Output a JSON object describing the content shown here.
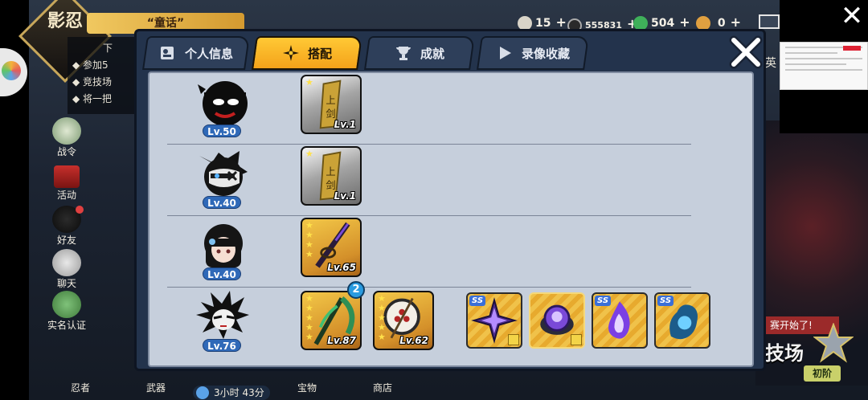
{
  "background": {
    "logo_text": "影忍",
    "banner_text": "“童话”",
    "quests": {
      "top": "下",
      "items": [
        "参加5",
        "竞技场",
        "将一把"
      ]
    },
    "side_buttons": [
      {
        "label": "战令",
        "icon": "battle-pass-icon"
      },
      {
        "label": "活动",
        "icon": "torii-gate-icon"
      },
      {
        "label": "好友",
        "icon": "friends-icon"
      },
      {
        "label": "聊天",
        "icon": "chat-icon"
      },
      {
        "label": "实名认证",
        "icon": "verify-icon"
      }
    ],
    "bottom_nav": [
      "忍者",
      "武器",
      "宝物",
      "商店"
    ],
    "timer": "3小时 43分",
    "resources": {
      "gold": "15",
      "silver": "555831",
      "gems": "504",
      "keys": "0"
    },
    "arena_banner": "赛开始了!",
    "arena_text": "技场",
    "rank_badge": "初阶",
    "right_edge_text": "英"
  },
  "modal": {
    "tabs": [
      {
        "label": "个人信息",
        "icon": "profile-card-icon",
        "active": false
      },
      {
        "label": "搭配",
        "icon": "shuriken-icon",
        "active": true
      },
      {
        "label": "成就",
        "icon": "trophy-icon",
        "active": false
      },
      {
        "label": "录像收藏",
        "icon": "play-icon",
        "active": false
      }
    ],
    "rows": [
      {
        "character": "stickman-ninja",
        "level": "Lv.50",
        "items": [
          {
            "type": "scroll",
            "frame": "silver",
            "stars": 1,
            "level": "Lv.1"
          }
        ],
        "skills": []
      },
      {
        "character": "masked-ninja",
        "level": "Lv.40",
        "items": [
          {
            "type": "scroll",
            "frame": "silver",
            "stars": 1,
            "level": "Lv.1"
          }
        ],
        "skills": []
      },
      {
        "character": "kunoichi",
        "level": "Lv.40",
        "items": [
          {
            "type": "katana",
            "frame": "gold",
            "stars": 4,
            "level": "Lv.65"
          }
        ],
        "skills": []
      },
      {
        "character": "white-hair-ninja",
        "level": "Lv.76",
        "items": [
          {
            "type": "scythe",
            "frame": "gold",
            "stars": 5,
            "level": "Lv.87",
            "badge": "2"
          },
          {
            "type": "shield",
            "frame": "gold",
            "stars": 5,
            "level": "Lv.62"
          }
        ],
        "skills": [
          {
            "grade": "SS",
            "icon": "purple-shuriken-icon"
          },
          {
            "grade": "",
            "icon": "purple-orb-icon"
          },
          {
            "grade": "SS",
            "icon": "purple-flame-icon"
          },
          {
            "grade": "SS",
            "icon": "blue-spirit-icon"
          }
        ]
      }
    ]
  }
}
